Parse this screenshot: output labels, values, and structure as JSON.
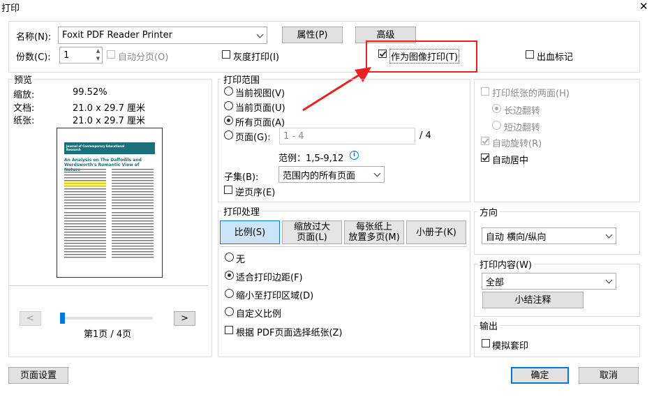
{
  "window": {
    "title": "打印",
    "close_glyph": "✕"
  },
  "printer": {
    "name_label": "名称(N):",
    "name_value": "Foxit PDF Reader Printer",
    "properties_button": "属性(P)",
    "advanced_button": "高级",
    "copies_label": "份数(C):",
    "copies_value": "1",
    "collate_label": "自动分页(O)",
    "grayscale_label": "灰度打印(I)",
    "print_as_image_label": "作为图像打印(T)",
    "bleed_marks_label": "出血标记"
  },
  "preview": {
    "title": "预览",
    "zoom_label": "缩放:",
    "zoom_value": "99.52%",
    "doc_label": "文档:",
    "doc_value": "21.0 x 29.7 厘米",
    "paper_label": "纸张:",
    "paper_value": "21.0 x 29.7 厘米",
    "thumb_journal": "Journal of Contemporary Educational Research",
    "thumb_title": "An Analysis on The Daffodils and Wordsworth's Romantic View of Nature",
    "prev_button": "<",
    "next_button": ">",
    "page_indicator": "第1页 / 4页",
    "slider_fraction": 0.0
  },
  "print_range": {
    "title": "打印范围",
    "current_view": "当前视图(V)",
    "current_page": "当前页面(U)",
    "all_pages": "所有页面(A)",
    "pages": "页面(G):",
    "pages_placeholder": "1 - 4",
    "pages_total": "/ 4",
    "example": "范例：1,5-9,12",
    "info_glyph": "i",
    "subset_label": "子集(B):",
    "subset_value": "范围内的所有页面",
    "reverse_label": "逆页序(E)"
  },
  "print_handling": {
    "title": "打印处理",
    "tabs": [
      "比例(S)",
      "缩放过大页面(L)",
      "每张纸上放置多页(M)",
      "小册子(K)"
    ],
    "tab_1_line1": "缩放过大",
    "tab_1_line2": "页面(L)",
    "tab_2_line1": "每张纸上",
    "tab_2_line2": "放置多页(M)",
    "none": "无",
    "fit_margins": "适合打印边距(F)",
    "shrink": "缩小至打印区域(D)",
    "custom": "自定义比例",
    "choose_paper": "根据 PDF页面选择纸张(Z)"
  },
  "duplex": {
    "both_sides": "打印纸张的两面(H)",
    "long_edge": "长边翻转",
    "short_edge": "短边翻转",
    "auto_rotate": "自动旋转(R)",
    "auto_center": "自动居中"
  },
  "orientation": {
    "title": "方向",
    "value": "自动 横向/纵向"
  },
  "content": {
    "title": "打印内容(W)",
    "value": "全部",
    "summarize_button": "小结注释"
  },
  "output": {
    "title": "输出",
    "simulate_overprint": "模拟套印"
  },
  "footer": {
    "page_setup": "页面设置",
    "ok": "确定",
    "cancel": "取消"
  },
  "colors": {
    "annotation_red": "#e8231f",
    "accent_blue": "#0078d7",
    "thumb_teal": "#1e6f7c"
  }
}
